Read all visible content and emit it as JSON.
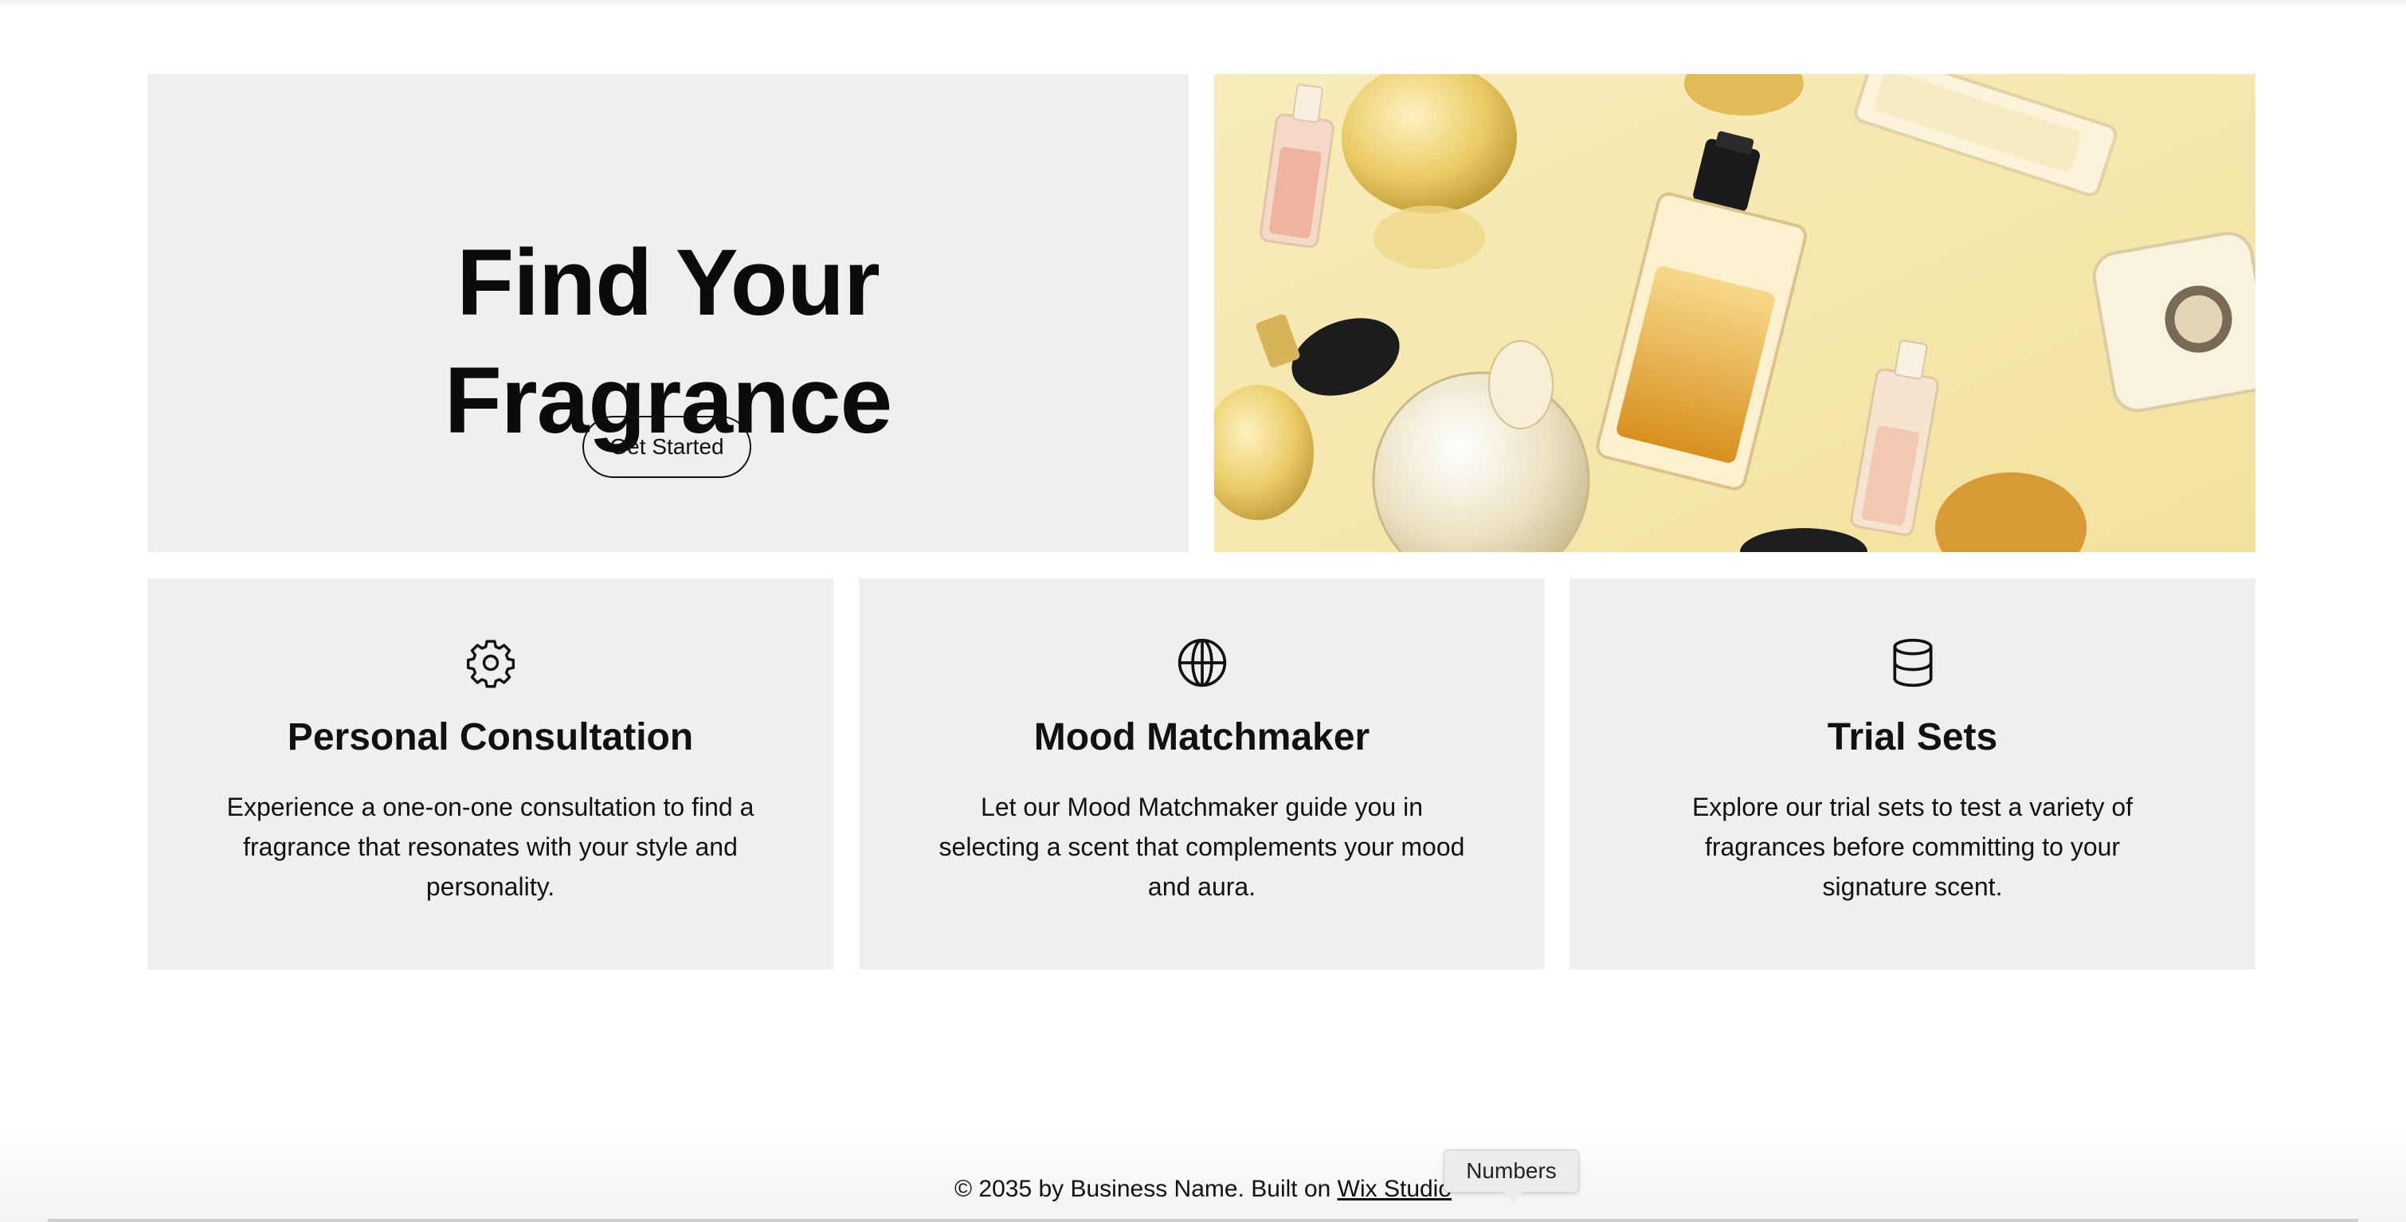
{
  "hero": {
    "title_line1": "Find Your",
    "title_line2": "Fragrance",
    "cta_label": "Get Started",
    "image_bg": "#f6e7ad"
  },
  "features": [
    {
      "icon": "gear-icon",
      "title": "Personal Consultation",
      "desc_lines": [
        "Experience a one-on-one consultation to find a",
        "fragrance that resonates with your style and",
        "personality."
      ]
    },
    {
      "icon": "globe-icon",
      "title": "Mood Matchmaker",
      "desc_lines": [
        "Let our Mood Matchmaker guide you in",
        "selecting a scent that complements your mood",
        "and aura."
      ]
    },
    {
      "icon": "database-icon",
      "title": "Trial Sets",
      "desc_lines": [
        "Explore our trial sets to test a variety of",
        "fragrances before committing to your",
        "signature scent."
      ]
    }
  ],
  "footer": {
    "text": "© 2035 by Business Name. Built on",
    "link": "Wix Studio"
  },
  "tooltip": {
    "label": "Numbers"
  },
  "colors": {
    "panel": "#efefef",
    "text": "#111111"
  }
}
